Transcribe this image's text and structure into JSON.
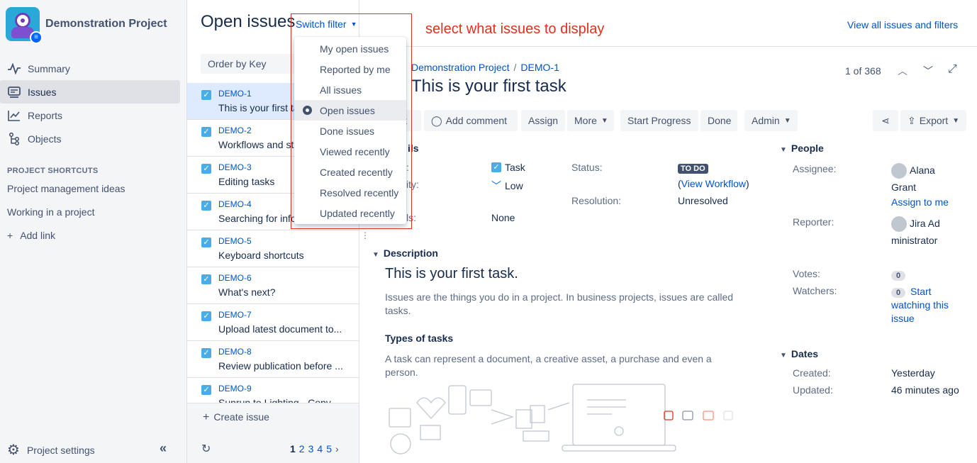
{
  "sidebar": {
    "project_name": "Demonstration Project",
    "nav": [
      {
        "label": "Summary",
        "icon": "activity-icon"
      },
      {
        "label": "Issues",
        "icon": "issues-icon"
      },
      {
        "label": "Reports",
        "icon": "reports-icon"
      },
      {
        "label": "Objects",
        "icon": "objects-icon"
      }
    ],
    "shortcuts_title": "PROJECT SHORTCUTS",
    "shortcuts": [
      "Project management ideas",
      "Working in a project"
    ],
    "add_link": "Add link",
    "project_settings": "Project settings"
  },
  "list": {
    "title": "Open issues",
    "switch_filter": "Switch filter",
    "order_by": "Order by Key",
    "issues": [
      {
        "key": "DEMO-1",
        "summary": "This is your first task"
      },
      {
        "key": "DEMO-2",
        "summary": "Workflows and statuses"
      },
      {
        "key": "DEMO-3",
        "summary": "Editing tasks"
      },
      {
        "key": "DEMO-4",
        "summary": "Searching for information"
      },
      {
        "key": "DEMO-5",
        "summary": "Keyboard shortcuts"
      },
      {
        "key": "DEMO-6",
        "summary": "What's next?"
      },
      {
        "key": "DEMO-7",
        "summary": "Upload latest document to..."
      },
      {
        "key": "DEMO-8",
        "summary": "Review publication before ..."
      },
      {
        "key": "DEMO-9",
        "summary": "Sunrun to Lighting - Copy"
      }
    ],
    "create_issue": "Create issue",
    "pages": [
      "1",
      "2",
      "3",
      "4",
      "5"
    ]
  },
  "filter_menu": {
    "items": [
      "My open issues",
      "Reported by me",
      "All issues",
      "Open issues",
      "Done issues",
      "Viewed recently",
      "Created recently",
      "Resolved recently",
      "Updated recently"
    ],
    "selected": "Open issues"
  },
  "annotation": "select what issues to display",
  "header": {
    "view_all": "View all issues and filters"
  },
  "detail": {
    "breadcrumb_project": "Demonstration Project",
    "breadcrumb_key": "DEMO-1",
    "counter": "1 of 368",
    "title": "This is your first task",
    "buttons": {
      "edit": "t",
      "comment": "Add comment",
      "assign": "Assign",
      "more": "More",
      "start": "Start Progress",
      "done": "Done",
      "admin": "Admin",
      "export": "Export"
    },
    "details_heading": "ils",
    "type_label": ":",
    "type_value": "Task",
    "priority_label": "ity:",
    "priority_value": "Low",
    "labels_label": "ls:",
    "labels_value": "None",
    "status_label": "Status:",
    "status_value": "TO DO",
    "view_workflow": "View Workflow",
    "resolution_label": "Resolution:",
    "resolution_value": "Unresolved",
    "description_heading": "Description",
    "desc_title": "This is your first task.",
    "desc_p1": "Issues are the things you do in a project. In business projects, issues are called tasks.",
    "types_heading": "Types of tasks",
    "desc_p2": "A task can represent a document, a creative asset, a purchase and even a person."
  },
  "people": {
    "heading": "People",
    "assignee_label": "Assignee:",
    "assignee": "Alana Grant",
    "assign_to_me": "Assign to me",
    "reporter_label": "Reporter:",
    "reporter": "Jira Administrator",
    "votes_label": "Votes:",
    "votes": "0",
    "watchers_label": "Watchers:",
    "watchers": "0",
    "start_watching": "Start watching this issue"
  },
  "dates": {
    "heading": "Dates",
    "created_label": "Created:",
    "created": "Yesterday",
    "updated_label": "Updated:",
    "updated": "46 minutes ago"
  }
}
